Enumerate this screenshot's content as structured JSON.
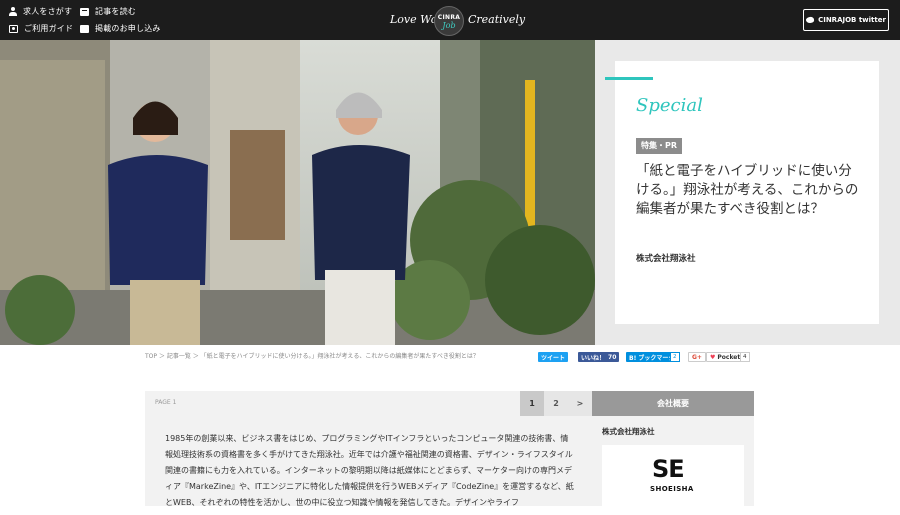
{
  "nav": {
    "find_jobs": "求人をさがす",
    "read_articles": "記事を読む",
    "guide": "ご利用ガイド",
    "apply_listing": "掲載のお申し込み"
  },
  "logo": {
    "left_script": "Love Work",
    "circle_top": "CINRA",
    "circle_bottom": "Job",
    "right_script": "Creatively"
  },
  "twitter_button": "CINRAJOB twitter",
  "feature": {
    "special": "Special",
    "tag": "特集・PR",
    "title": "「紙と電子をハイブリッドに使い分ける。」翔泳社が考える、これからの編集者が果たすべき役割とは？",
    "company": "株式会社翔泳社"
  },
  "breadcrumb": "TOP ＞ 記事一覧 ＞ 「紙と電子をハイブリッドに使い分ける。」翔泳社が考える、これからの編集者が果たすべき役割とは？",
  "share": {
    "tweet": "ツイート",
    "like": "いいね！",
    "like_count": "70",
    "bookmark": "B! ブックマーク",
    "bookmark_count": "2",
    "gplus": "G+",
    "pocket": "Pocket",
    "pocket_count": "4"
  },
  "pagination": {
    "label": "PAGE 1",
    "pages": [
      "1",
      "2"
    ],
    "next": ">"
  },
  "article_text": "1985年の創業以来、ビジネス書をはじめ、プログラミングやITインフラといったコンピュータ関連の技術書、情報処理技術系の資格書を多く手がけてきた翔泳社。近年では介護や福祉関連の資格書、デザイン・ライフスタイル関連の書籍にも力を入れている。インターネットの黎明期以降は紙媒体にとどまらず、マーケター向けの専門メディア『MarkeZine』や、ITエンジニアに特化した情報提供を行うWEBメディア『CodeZine』を運営するなど、紙とWEB、それぞれの特性を活かし、世の中に役立つ知識や情報を発信してきた。デザインやライフ",
  "sidebar": {
    "heading": "会社概要",
    "company_name": "株式会社翔泳社",
    "logo_mark": "SE",
    "logo_word": "SHOEISHA"
  },
  "colors": {
    "teal": "#2ec5bd",
    "topbar": "#1c1c1c",
    "twitter": "#1da1f2",
    "facebook": "#3b5998",
    "hatena": "#008fde",
    "pocket": "#ee4056"
  }
}
